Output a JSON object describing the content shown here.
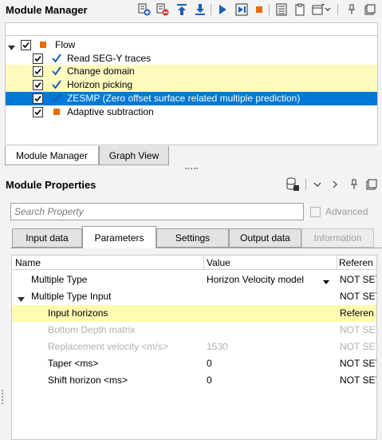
{
  "module_manager": {
    "title": "Module Manager",
    "toolbar_icons": [
      "add-module-icon",
      "remove-module-icon",
      "move-up-icon",
      "move-down-icon",
      "run-icon",
      "run-step-icon",
      "stop-icon",
      "log-icon",
      "clipboard-icon",
      "window-menu-icon",
      "pin-icon",
      "float-icon"
    ],
    "tree": {
      "root_label": "Flow",
      "items": [
        {
          "label": "Read SEG-Y traces",
          "checked": true,
          "status": "check"
        },
        {
          "label": "Change domain",
          "checked": true,
          "status": "check"
        },
        {
          "label": "Horizon picking",
          "checked": true,
          "status": "check"
        },
        {
          "label": "ZESMP  (Zero offset surface related multiple prediction)",
          "checked": true,
          "status": "check"
        },
        {
          "label": "Adaptive subtraction",
          "checked": true,
          "status": "square"
        }
      ]
    },
    "tabs": [
      "Module Manager",
      "Graph View"
    ]
  },
  "module_properties": {
    "title": "Module Properties",
    "search_placeholder": "Search Property",
    "advanced_label": "Advanced",
    "tabs": [
      "Input data",
      "Parameters",
      "Settings",
      "Output data",
      "Information"
    ],
    "columns": [
      "Name",
      "Value",
      "Referen"
    ],
    "rows": [
      {
        "name": "Multiple Type",
        "value": "Horizon Velocity model",
        "ref": "NOT SET"
      },
      {
        "name": "Multiple Type Input",
        "value": "",
        "ref": "NOT SET"
      },
      {
        "name": "Input horizons",
        "value": "",
        "ref": "Referen"
      },
      {
        "name": "Bottom Depth matrix",
        "value": "",
        "ref": "NOT SET"
      },
      {
        "name": "Replacement velocity <m/s>",
        "value": "1530",
        "ref": "NOT SET"
      },
      {
        "name": "Taper <ms>",
        "value": "0",
        "ref": "NOT SET"
      },
      {
        "name": "Shift horizon <ms>",
        "value": "0",
        "ref": "NOT SET"
      }
    ]
  },
  "colors": {
    "selection": "#0078d7",
    "highlight": "#fffbc0",
    "check": "#1a5fb4",
    "accent": "#e46c0a"
  }
}
